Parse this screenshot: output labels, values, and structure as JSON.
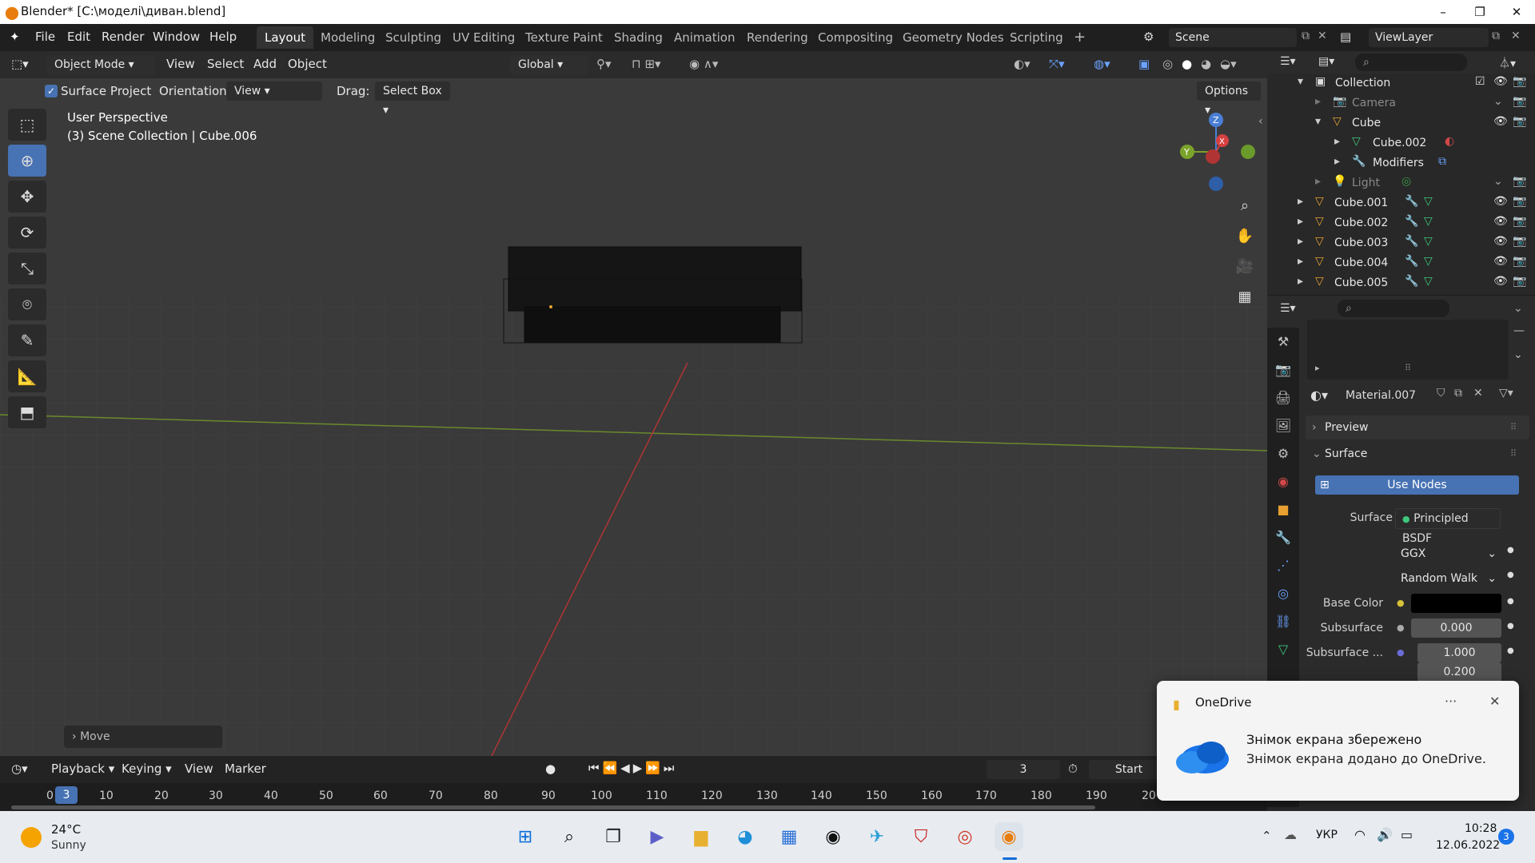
{
  "window": {
    "title": "Blender* [C:\\моделі\\диван.blend]",
    "controls": [
      "–",
      "❐",
      "✕"
    ]
  },
  "topbar": {
    "menus": [
      "File",
      "Edit",
      "Render",
      "Window",
      "Help"
    ],
    "workspaces": [
      "Layout",
      "Modeling",
      "Sculpting",
      "UV Editing",
      "Texture Paint",
      "Shading",
      "Animation",
      "Rendering",
      "Compositing",
      "Geometry Nodes",
      "Scripting"
    ],
    "active_workspace": "Layout",
    "add_tab": "+",
    "scene": "Scene",
    "view_layer": "ViewLayer"
  },
  "viewport_header": {
    "mode": "Object Mode",
    "menus": [
      "View",
      "Select",
      "Add",
      "Object"
    ],
    "orientation_global": "Global",
    "surface_project": "Surface Project",
    "orientation_label": "Orientation:",
    "orientation_value": "View",
    "drag_label": "Drag:",
    "drag_value": "Select Box",
    "options": "Options"
  },
  "viewport": {
    "perspective": "User Perspective",
    "scene_info": "(3) Scene Collection | Cube.006",
    "gizmo_z": "Z",
    "gizmo_y": "Y",
    "gizmo_x": "X",
    "last_op": "Move"
  },
  "outliner": {
    "rows": [
      {
        "name": "Collection",
        "indent": 0
      },
      {
        "name": "Camera",
        "indent": 1
      },
      {
        "name": "Cube",
        "indent": 1
      },
      {
        "name": "Cube.002",
        "indent": 2
      },
      {
        "name": "Modifiers",
        "indent": 2
      },
      {
        "name": "Light",
        "indent": 1
      },
      {
        "name": "Cube.001",
        "indent": 0
      },
      {
        "name": "Cube.002",
        "indent": 0
      },
      {
        "name": "Cube.003",
        "indent": 0
      },
      {
        "name": "Cube.004",
        "indent": 0
      },
      {
        "name": "Cube.005",
        "indent": 0
      }
    ]
  },
  "properties": {
    "material_name": "Material.007",
    "preview_label": "Preview",
    "surface_section": "Surface",
    "use_nodes": "Use Nodes",
    "surface_label": "Surface",
    "surface_value": "Principled BSDF",
    "distribution": "GGX",
    "subsurface_method": "Random Walk",
    "base_color_label": "Base Color",
    "subsurface_label": "Subsurface",
    "subsurface_value": "0.000",
    "subsurface_radius_label": "Subsurface ...",
    "subsurface_radius_1": "1.000",
    "subsurface_radius_2": "0.200",
    "base_color_hex": "#000000",
    "accent": "#4772b3"
  },
  "timeline": {
    "menus": [
      "Playback",
      "Keying",
      "View",
      "Marker"
    ],
    "current_frame": "3",
    "start_label": "Start",
    "ticks": [
      "0",
      "10",
      "20",
      "30",
      "40",
      "50",
      "60",
      "70",
      "80",
      "90",
      "100",
      "110",
      "120",
      "130",
      "140",
      "150",
      "160",
      "170",
      "180",
      "190",
      "20"
    ],
    "frame_marker": "3"
  },
  "toast": {
    "app": "OneDrive",
    "more": "···",
    "title": "Знімок екрана збережено",
    "body": "Знімок екрана додано до OneDrive."
  },
  "taskbar": {
    "temp": "24°C",
    "weather": "Sunny",
    "lang": "УКР",
    "time": "10:28",
    "date": "12.06.2022",
    "notif_count": "3"
  }
}
